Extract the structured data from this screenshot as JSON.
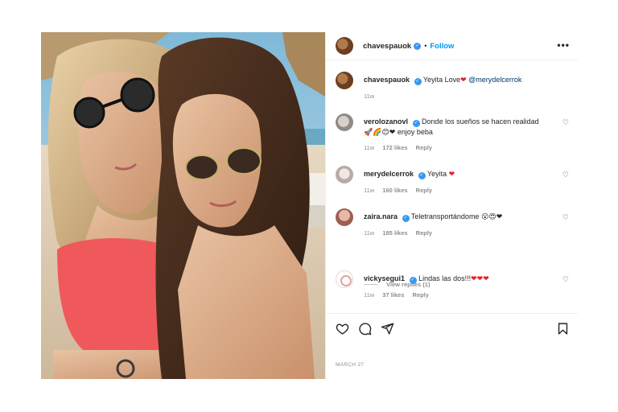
{
  "post": {
    "username": "chavespauok",
    "follow_label": "Follow",
    "more_label": "•••",
    "separator": "•",
    "caption": {
      "username": "chavespauok",
      "text": "Yeyita Love",
      "emoji": "❤",
      "mention": "@merydelcerrok",
      "time": "11w"
    },
    "comments": [
      {
        "username": "verolozanovl",
        "text": "Donde los sueños se hacen realidad",
        "text2_emoji": "🚀🌈😊❤",
        "text2": "enjoy beba",
        "time": "11w",
        "likes": "172 likes",
        "reply": "Reply"
      },
      {
        "username": "merydelcerrok",
        "text": "Yeyita",
        "emoji": "❤",
        "time": "11w",
        "likes": "160 likes",
        "reply": "Reply"
      },
      {
        "username": "zaira.nara",
        "text": "Teletransportándome",
        "emoji": "😮😍❤",
        "time": "11w",
        "likes": "185 likes",
        "reply": "Reply"
      },
      {
        "username": "vickysegui1",
        "text": "Lindas las dos!!!",
        "emoji": "❤❤❤",
        "time": "11w",
        "likes": "37 likes",
        "reply": "Reply"
      }
    ],
    "view_replies": "View replies (1)",
    "date": "MARCH 27"
  },
  "icons": {
    "verified": "verified-badge-icon",
    "like": "heart-outline-icon",
    "comment": "comment-bubble-icon",
    "share": "paper-plane-icon",
    "save": "bookmark-icon",
    "more": "more-options-icon"
  },
  "colors": {
    "link_blue": "#0095f6",
    "verified_blue": "#3897f0",
    "heart_red": "#ed1c24",
    "muted": "#8e8e8e",
    "mention": "#00376b"
  }
}
